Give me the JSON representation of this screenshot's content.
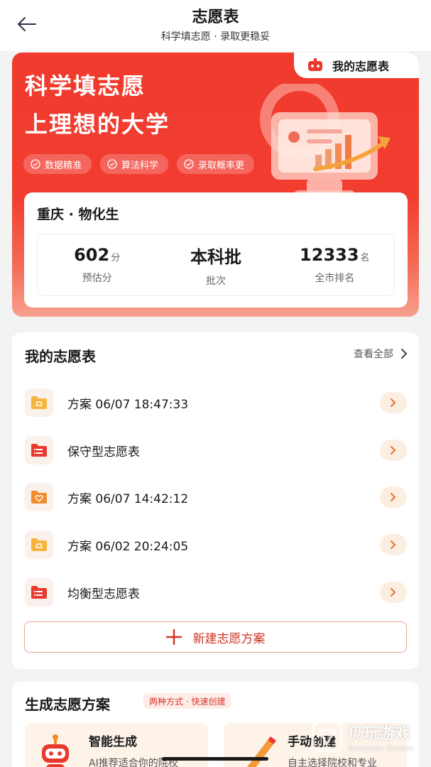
{
  "header": {
    "title": "志愿表",
    "subtitle": "科学填志愿 · 录取更稳妥",
    "back_icon": "arrow-left-icon"
  },
  "hero": {
    "tab_label": "我的志愿表",
    "headline_1": "科学填志愿",
    "headline_2": "上理想的大学",
    "chips": [
      "数据精准",
      "算法科学",
      "录取概率更"
    ],
    "accent_color": "#f03a2e"
  },
  "score": {
    "province_subjects": "重庆 · 物化生",
    "stats": [
      {
        "value": "602",
        "unit": "分",
        "caption": "预估分"
      },
      {
        "value": "本科批",
        "unit": "",
        "caption": "批次"
      },
      {
        "value": "12333",
        "unit": "名",
        "caption": "全市排名"
      }
    ]
  },
  "my_list": {
    "title": "我的志愿表",
    "see_all": "查看全部",
    "plans": [
      {
        "label": "方案 06/07 18:47:33",
        "icon": "folder-icon"
      },
      {
        "label": "保守型志愿表",
        "icon": "list-folder-icon"
      },
      {
        "label": "方案 06/07 14:42:12",
        "icon": "heart-folder-icon"
      },
      {
        "label": "方案 06/02 20:24:05",
        "icon": "folder-icon"
      },
      {
        "label": "均衡型志愿表",
        "icon": "list-folder-icon"
      }
    ],
    "new_label": "新建志愿方案"
  },
  "generate": {
    "title": "生成志愿方案",
    "badge": "两种方式 · 快速创建",
    "options": [
      {
        "name": "智能生成",
        "desc": "AI推荐适合你的院校"
      },
      {
        "name": "手动创建",
        "desc": "自主选择院校和专业"
      }
    ]
  },
  "watermark": {
    "cn": "仍玩游戏",
    "en": "Rengwan Games"
  }
}
